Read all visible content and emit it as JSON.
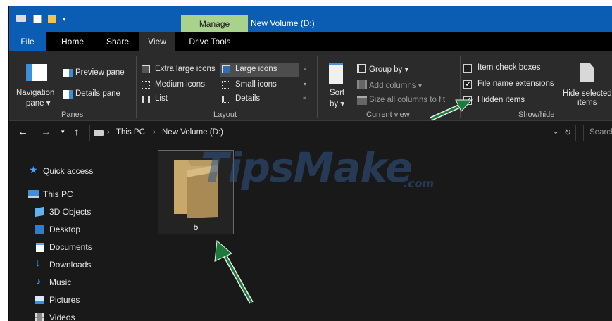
{
  "window": {
    "title": "New Volume (D:)",
    "context_tab": "Manage"
  },
  "tabs": [
    {
      "label": "File"
    },
    {
      "label": "Home"
    },
    {
      "label": "Share"
    },
    {
      "label": "View"
    },
    {
      "label": "Drive Tools"
    }
  ],
  "ribbon": {
    "panes": {
      "navigation_pane_line1": "Navigation",
      "navigation_pane_line2": "pane",
      "preview_pane": "Preview pane",
      "details_pane": "Details pane",
      "group_label": "Panes"
    },
    "layout": {
      "options": [
        "Extra large icons",
        "Large icons",
        "Medium icons",
        "Small icons",
        "List",
        "Details"
      ],
      "selected": "Large icons",
      "group_label": "Layout"
    },
    "current_view": {
      "sort_by_line1": "Sort",
      "sort_by_line2": "by",
      "group_by": "Group by",
      "add_columns": "Add columns",
      "size_all_columns": "Size all columns to fit",
      "group_label": "Current view"
    },
    "show_hide": {
      "item_check_boxes": {
        "label": "Item check boxes",
        "checked": false
      },
      "file_name_extensions": {
        "label": "File name extensions",
        "checked": true
      },
      "hidden_items": {
        "label": "Hidden items",
        "checked": true
      },
      "hide_selected_line1": "Hide selected",
      "hide_selected_line2": "items",
      "group_label": "Show/hide"
    }
  },
  "address_bar": {
    "breadcrumb": [
      "This PC",
      "New Volume (D:)"
    ],
    "search_placeholder": "Search"
  },
  "nav_pane": {
    "items": [
      {
        "label": "Quick access",
        "icon": "star-icon"
      },
      {
        "label": "This PC",
        "icon": "monitor-icon"
      },
      {
        "label": "3D Objects",
        "icon": "cube-icon"
      },
      {
        "label": "Desktop",
        "icon": "desktop-icon"
      },
      {
        "label": "Documents",
        "icon": "document-icon"
      },
      {
        "label": "Downloads",
        "icon": "download-icon"
      },
      {
        "label": "Music",
        "icon": "music-icon"
      },
      {
        "label": "Pictures",
        "icon": "picture-icon"
      },
      {
        "label": "Videos",
        "icon": "video-icon"
      }
    ]
  },
  "content": {
    "items": [
      {
        "name": "b",
        "type": "folder"
      }
    ]
  },
  "watermark": {
    "main": "TipsMake",
    "suffix": ".com"
  },
  "colors": {
    "title_bar": "#0a5db3",
    "context_tab": "#a9d28c",
    "ribbon": "#2b2b2b",
    "window_bg": "#191919",
    "arrow": "#1e7a3c",
    "folder": "#c9a96b"
  }
}
